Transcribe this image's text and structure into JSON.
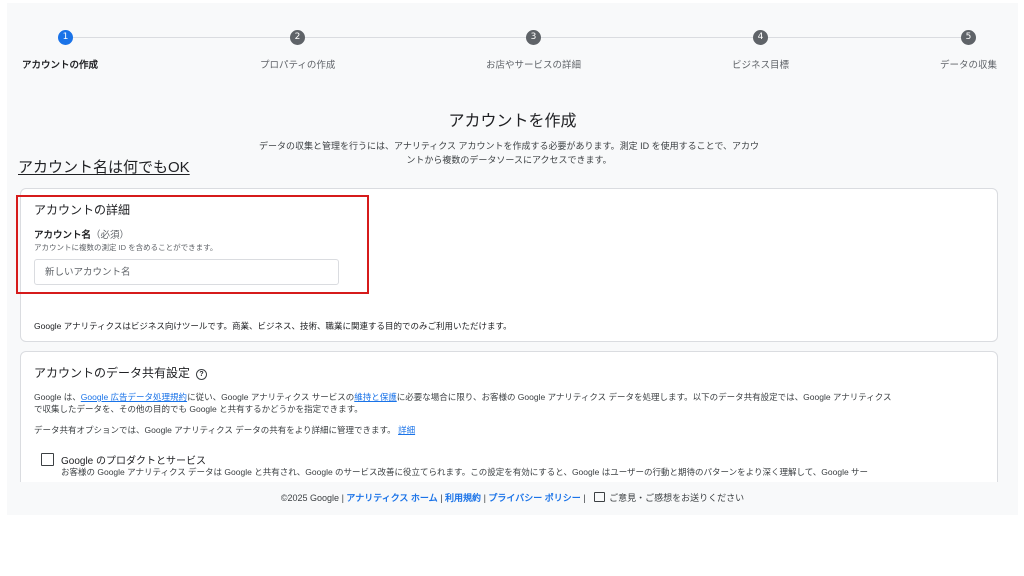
{
  "stepper": {
    "steps": [
      {
        "number": "1",
        "label": "アカウントの作成"
      },
      {
        "number": "2",
        "label": "プロパティの作成"
      },
      {
        "number": "3",
        "label": "お店やサービスの詳細"
      },
      {
        "number": "4",
        "label": "ビジネス目標"
      },
      {
        "number": "5",
        "label": "データの収集"
      }
    ],
    "current_step": 1
  },
  "page": {
    "heading": "アカウントを作成",
    "intro_line1": "データの収集と管理を行うには、アナリティクス アカウントを作成する必要があります。測定 ID を使用することで、アカウ",
    "intro_line2": "ントから複数のデータソースにアクセスできます。"
  },
  "annotation": {
    "text": "アカウント名は何でもOK",
    "box_color": "#d61b1b"
  },
  "account_details": {
    "title": "アカウントの詳細",
    "name_label": "アカウント名",
    "name_required": "（必須）",
    "name_hint": "アカウントに複数の測定 ID を含めることができます。",
    "name_placeholder": "新しいアカウント名",
    "name_value": "",
    "footnote": "Google アナリティクスはビジネス向けツールです。商業、ビジネス、技術、職業に関連する目的でのみご利用いただけます。"
  },
  "data_sharing": {
    "title": "アカウントのデータ共有設定",
    "help_icon": "help-circle-icon",
    "desc_part1": "Google は、",
    "desc_link1": "Google 広告データ処理規約",
    "desc_part2": "に従い、Google アナリティクス サービスの",
    "desc_link2": "維持と保護",
    "desc_part3": "に必要な場合に限り、お客様の Google アナリティクス データを処理します。以下のデータ共有設定では、Google アナリティクス",
    "desc_line2": "で収集したデータを、その他の目的でも Google と共有するかどうかを指定できます。",
    "options_text": "データ共有オプションでは、Google アナリティクス データの共有をより詳細に管理できます。",
    "options_link": "詳細",
    "option1": {
      "label": "Google のプロダクトとサービス",
      "checked": false,
      "desc_line1": "お客様の Google アナリティクス データは Google と共有され、Google のサービス改善に役立てられます。この設定を有効にすると、Google はユーザーの行動と期待のパターンをより深く理解して、Google サー"
    }
  },
  "footer": {
    "copyright": "©2025 Google",
    "link_home": "アナリティクス ホーム",
    "link_terms": "利用規約",
    "link_privacy": "プライバシー ポリシー",
    "feedback": "ご意見・ご感想をお送りください",
    "feedback_icon": "feedback-icon"
  },
  "colors": {
    "accent": "#1a73e8",
    "annotation_red": "#d61b1b",
    "page_bg": "#f8f9fa"
  }
}
